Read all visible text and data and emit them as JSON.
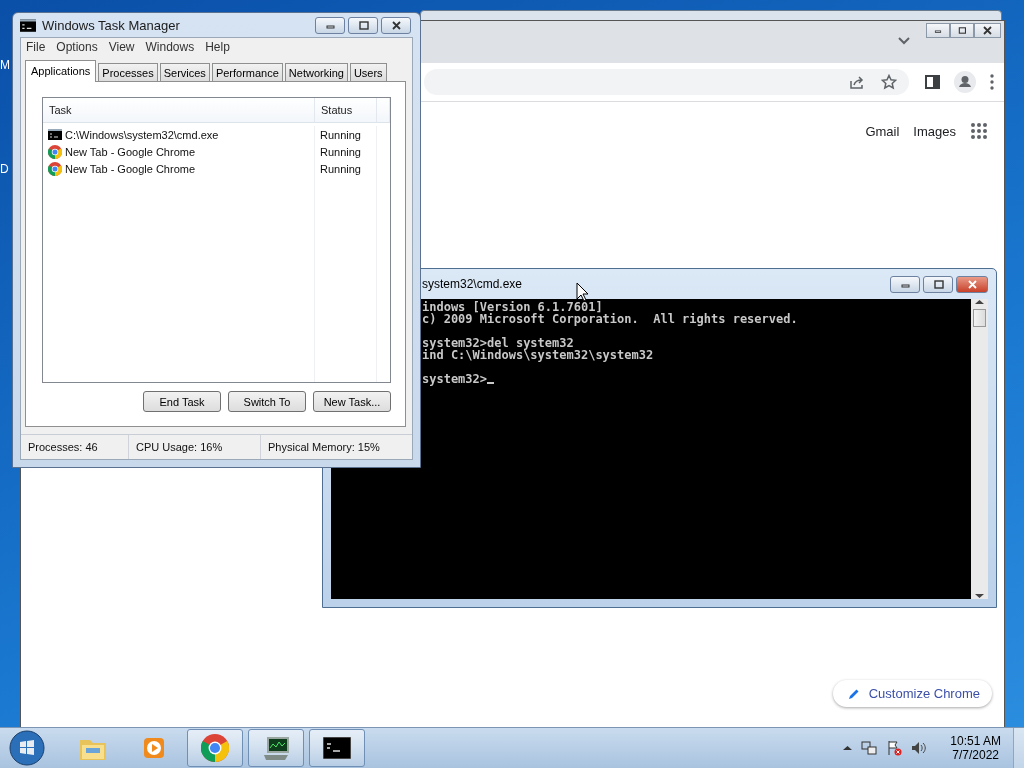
{
  "desktop": {
    "icon_labels": [
      "M",
      "D"
    ]
  },
  "chrome": {
    "header_links": [
      "Gmail",
      "Images"
    ],
    "customize_button": "Customize Chrome"
  },
  "cmd_window": {
    "title": "system32\\cmd.exe",
    "blocks": [
      [
        "indows [Version 6.1.7601]",
        "c) 2009 Microsoft Corporation.  All rights reserved."
      ],
      [
        "system32>del system32",
        "ind C:\\Windows\\system32\\system32"
      ],
      [
        "system32>"
      ]
    ]
  },
  "task_manager": {
    "title": "Windows Task Manager",
    "menu": [
      "File",
      "Options",
      "View",
      "Windows",
      "Help"
    ],
    "tabs": [
      {
        "label": "Applications",
        "selected": true
      },
      {
        "label": "Processes",
        "selected": false
      },
      {
        "label": "Services",
        "selected": false
      },
      {
        "label": "Performance",
        "selected": false
      },
      {
        "label": "Networking",
        "selected": false
      },
      {
        "label": "Users",
        "selected": false
      }
    ],
    "columns": [
      "Task",
      "Status"
    ],
    "rows": [
      {
        "kind": "console",
        "task": "C:\\Windows\\system32\\cmd.exe",
        "status": "Running"
      },
      {
        "kind": "chrome",
        "task": "New Tab - Google Chrome",
        "status": "Running"
      },
      {
        "kind": "chrome",
        "task": "New Tab - Google Chrome",
        "status": "Running"
      }
    ],
    "buttons": [
      "End Task",
      "Switch To",
      "New Task..."
    ],
    "status_bar": [
      "Processes: 46",
      "CPU Usage: 16%",
      "Physical Memory: 15%"
    ]
  },
  "taskbar": {
    "items": [
      {
        "kind": "explorer",
        "open": false
      },
      {
        "kind": "media",
        "open": false
      },
      {
        "kind": "chrome",
        "open": true
      },
      {
        "kind": "taskmgr",
        "open": true
      },
      {
        "kind": "console",
        "open": true
      }
    ],
    "clock": {
      "time": "10:51 AM",
      "date": "7/7/2022"
    }
  }
}
